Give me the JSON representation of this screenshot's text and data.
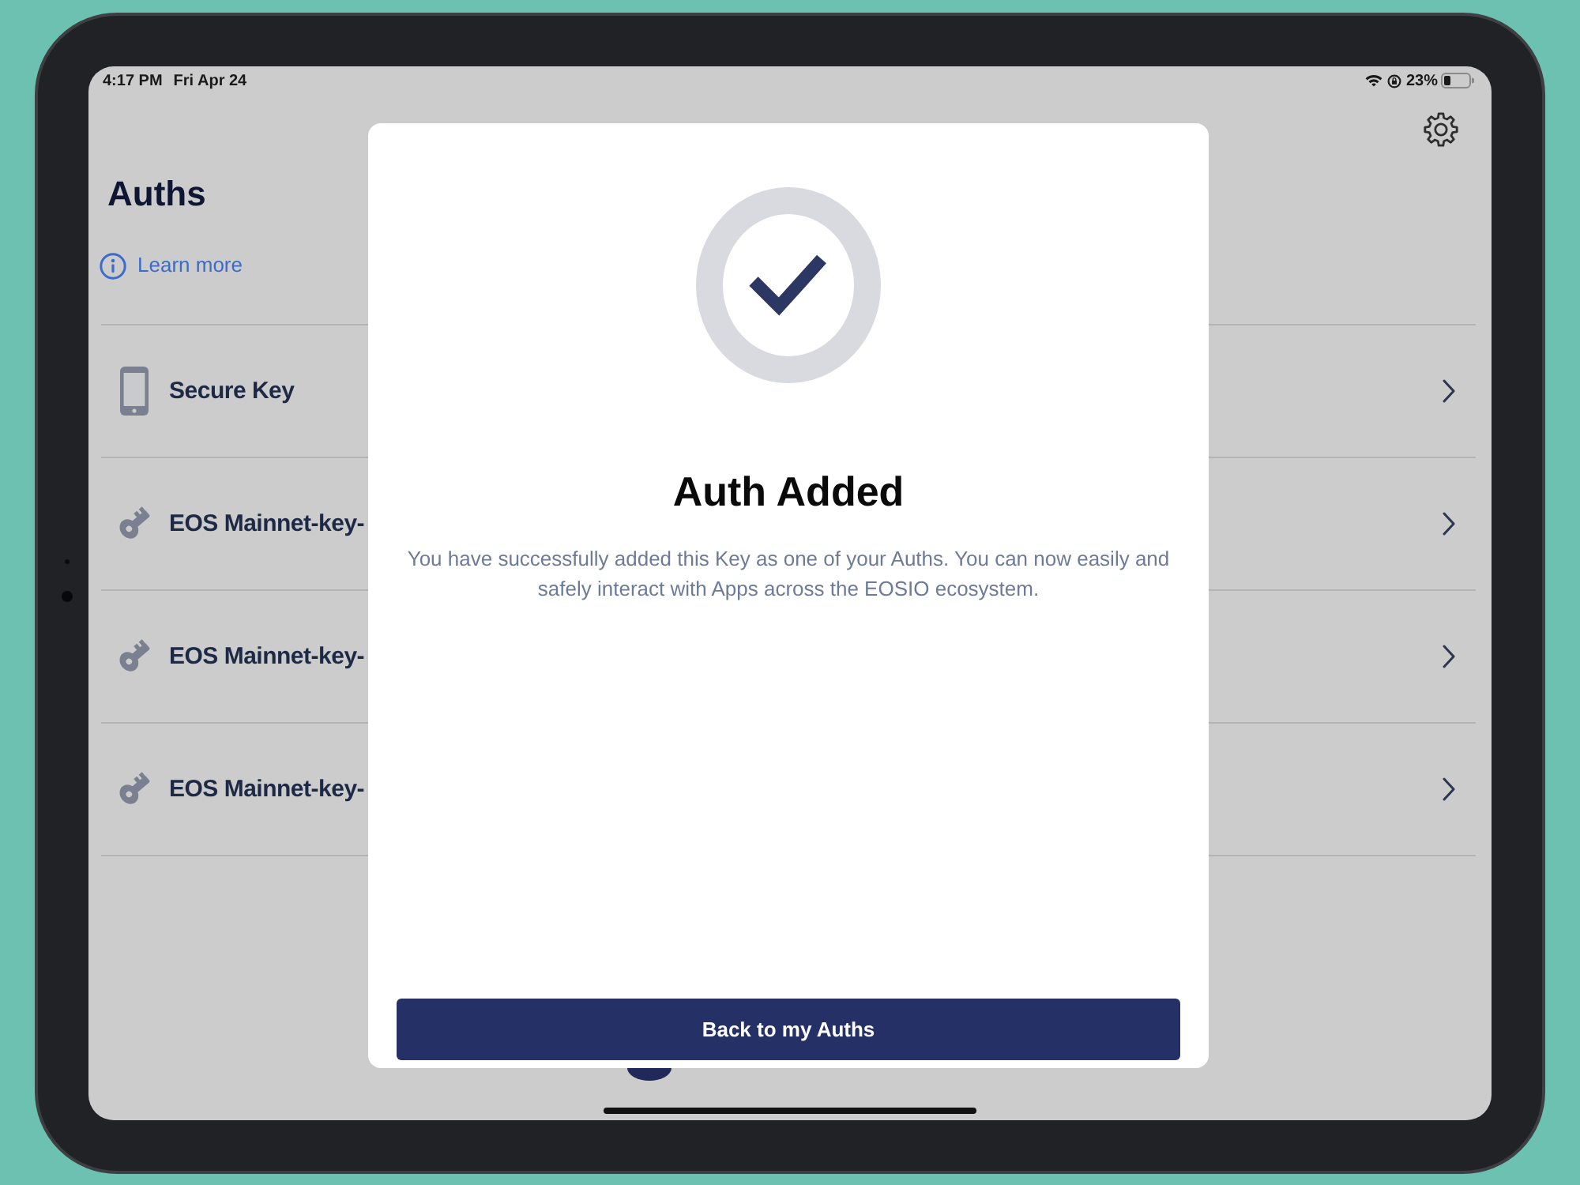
{
  "status_bar": {
    "time": "4:17 PM",
    "date": "Fri Apr 24",
    "battery": "23%"
  },
  "header": {
    "title": "Auths",
    "link": "Learn more"
  },
  "auths": [
    {
      "kind": "device",
      "name": "Secure Key"
    },
    {
      "kind": "key",
      "name": "EOS Mainnet-key-"
    },
    {
      "kind": "key",
      "name": "EOS Mainnet-key-"
    },
    {
      "kind": "key",
      "name": "EOS Mainnet-key-"
    }
  ],
  "dialog": {
    "title": "Auth Added",
    "message": "You have successfully added this Key as one of your Auths. You can now easily and safely interact with Apps across the EOSIO ecosystem.",
    "button": "Back to my Auths"
  }
}
